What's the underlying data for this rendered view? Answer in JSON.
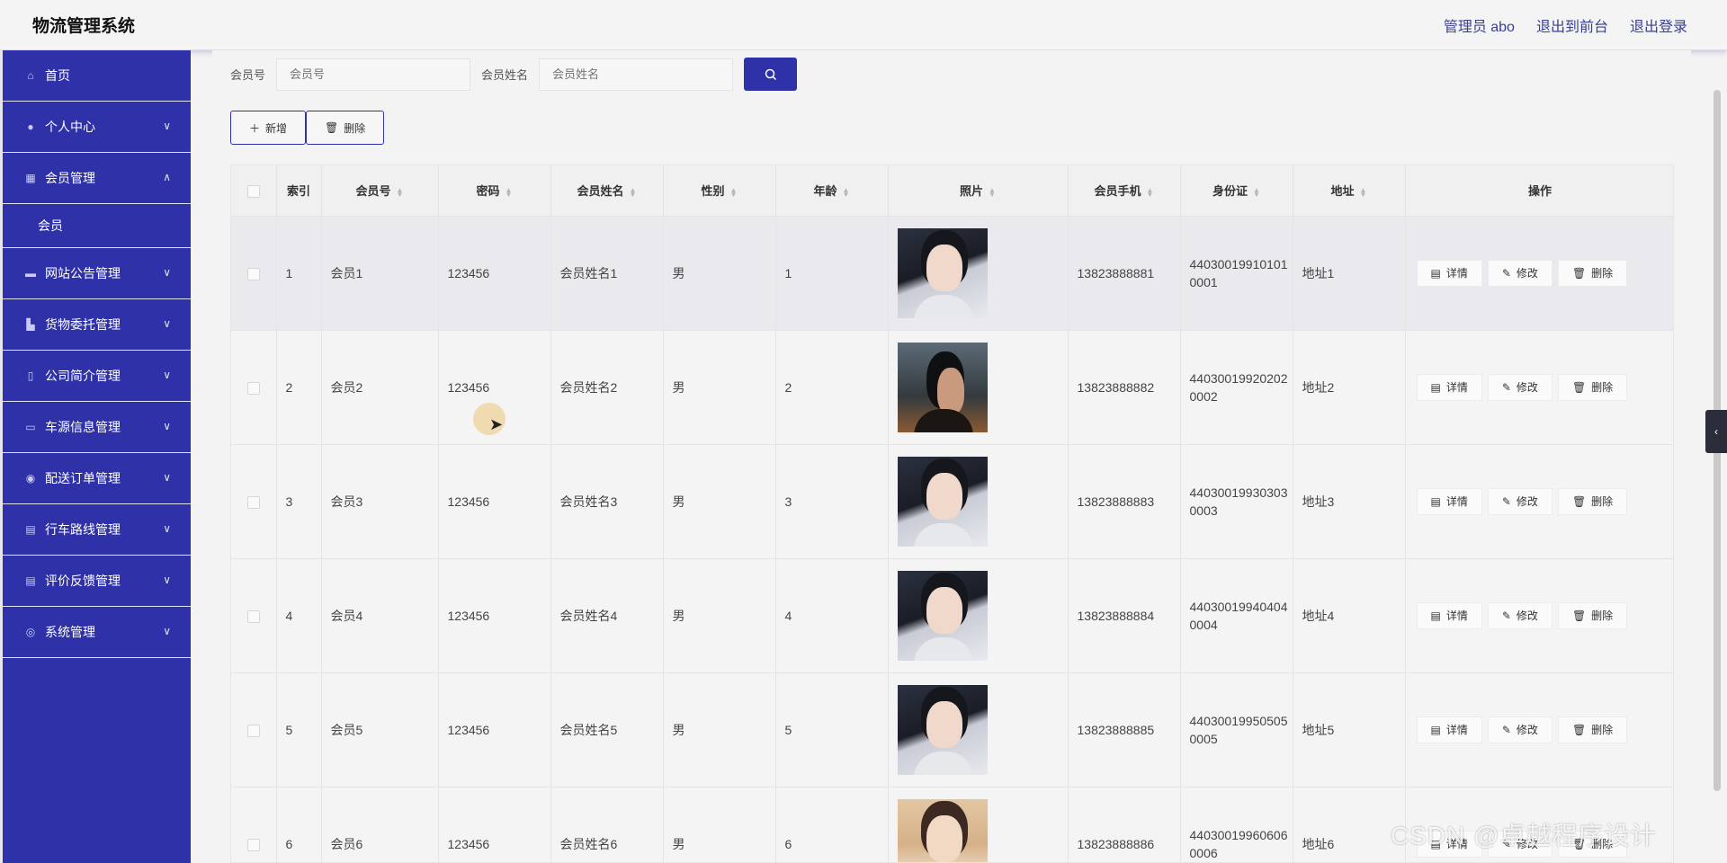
{
  "header": {
    "title": "物流管理系统",
    "user": "管理员 abo",
    "to_front": "退出到前台",
    "logout": "退出登录"
  },
  "sidebar": {
    "items": [
      {
        "label": "首页",
        "icon": "home-icon"
      },
      {
        "label": "个人中心",
        "icon": "user-icon"
      },
      {
        "label": "会员管理",
        "icon": "grid-icon",
        "expanded": true,
        "sub": "会员"
      },
      {
        "label": "网站公告管理",
        "icon": "briefcase-icon"
      },
      {
        "label": "货物委托管理",
        "icon": "box-icon"
      },
      {
        "label": "公司简介管理",
        "icon": "phone-icon"
      },
      {
        "label": "车源信息管理",
        "icon": "chat-icon"
      },
      {
        "label": "配送订单管理",
        "icon": "location-icon"
      },
      {
        "label": "行车路线管理",
        "icon": "document-icon"
      },
      {
        "label": "评价反馈管理",
        "icon": "doc-icon"
      },
      {
        "label": "系统管理",
        "icon": "settings-icon"
      }
    ]
  },
  "filters": {
    "member_no_label": "会员号",
    "member_no_placeholder": "会员号",
    "member_name_label": "会员姓名",
    "member_name_placeholder": "会员姓名"
  },
  "actions": {
    "add": "新增",
    "delete": "删除"
  },
  "table": {
    "headers": [
      "索引",
      "会员号",
      "密码",
      "会员姓名",
      "性别",
      "年龄",
      "照片",
      "会员手机",
      "身份证",
      "地址",
      "操作"
    ],
    "ops": {
      "detail": "详情",
      "edit": "修改",
      "delete": "删除"
    },
    "rows": [
      {
        "index": "1",
        "member_no": "会员1",
        "password": "123456",
        "name": "会员姓名1",
        "gender": "男",
        "age": "1",
        "phone": "13823888881",
        "id_card": "440300199101010001",
        "address": "地址1"
      },
      {
        "index": "2",
        "member_no": "会员2",
        "password": "123456",
        "name": "会员姓名2",
        "gender": "男",
        "age": "2",
        "phone": "13823888882",
        "id_card": "440300199202020002",
        "address": "地址2"
      },
      {
        "index": "3",
        "member_no": "会员3",
        "password": "123456",
        "name": "会员姓名3",
        "gender": "男",
        "age": "3",
        "phone": "13823888883",
        "id_card": "440300199303030003",
        "address": "地址3"
      },
      {
        "index": "4",
        "member_no": "会员4",
        "password": "123456",
        "name": "会员姓名4",
        "gender": "男",
        "age": "4",
        "phone": "13823888884",
        "id_card": "440300199404040004",
        "address": "地址4"
      },
      {
        "index": "5",
        "member_no": "会员5",
        "password": "123456",
        "name": "会员姓名5",
        "gender": "男",
        "age": "5",
        "phone": "13823888885",
        "id_card": "440300199505050005",
        "address": "地址5"
      },
      {
        "index": "6",
        "member_no": "会员6",
        "password": "123456",
        "name": "会员姓名6",
        "gender": "男",
        "age": "6",
        "phone": "13823888886",
        "id_card": "440300199606060006",
        "address": "地址6"
      }
    ]
  },
  "watermark": "CSDN @卓越程序设计",
  "colors": {
    "primary": "#2f31a8",
    "header_bg": "#f4f4f4",
    "content_bg": "#f3f3f3"
  }
}
